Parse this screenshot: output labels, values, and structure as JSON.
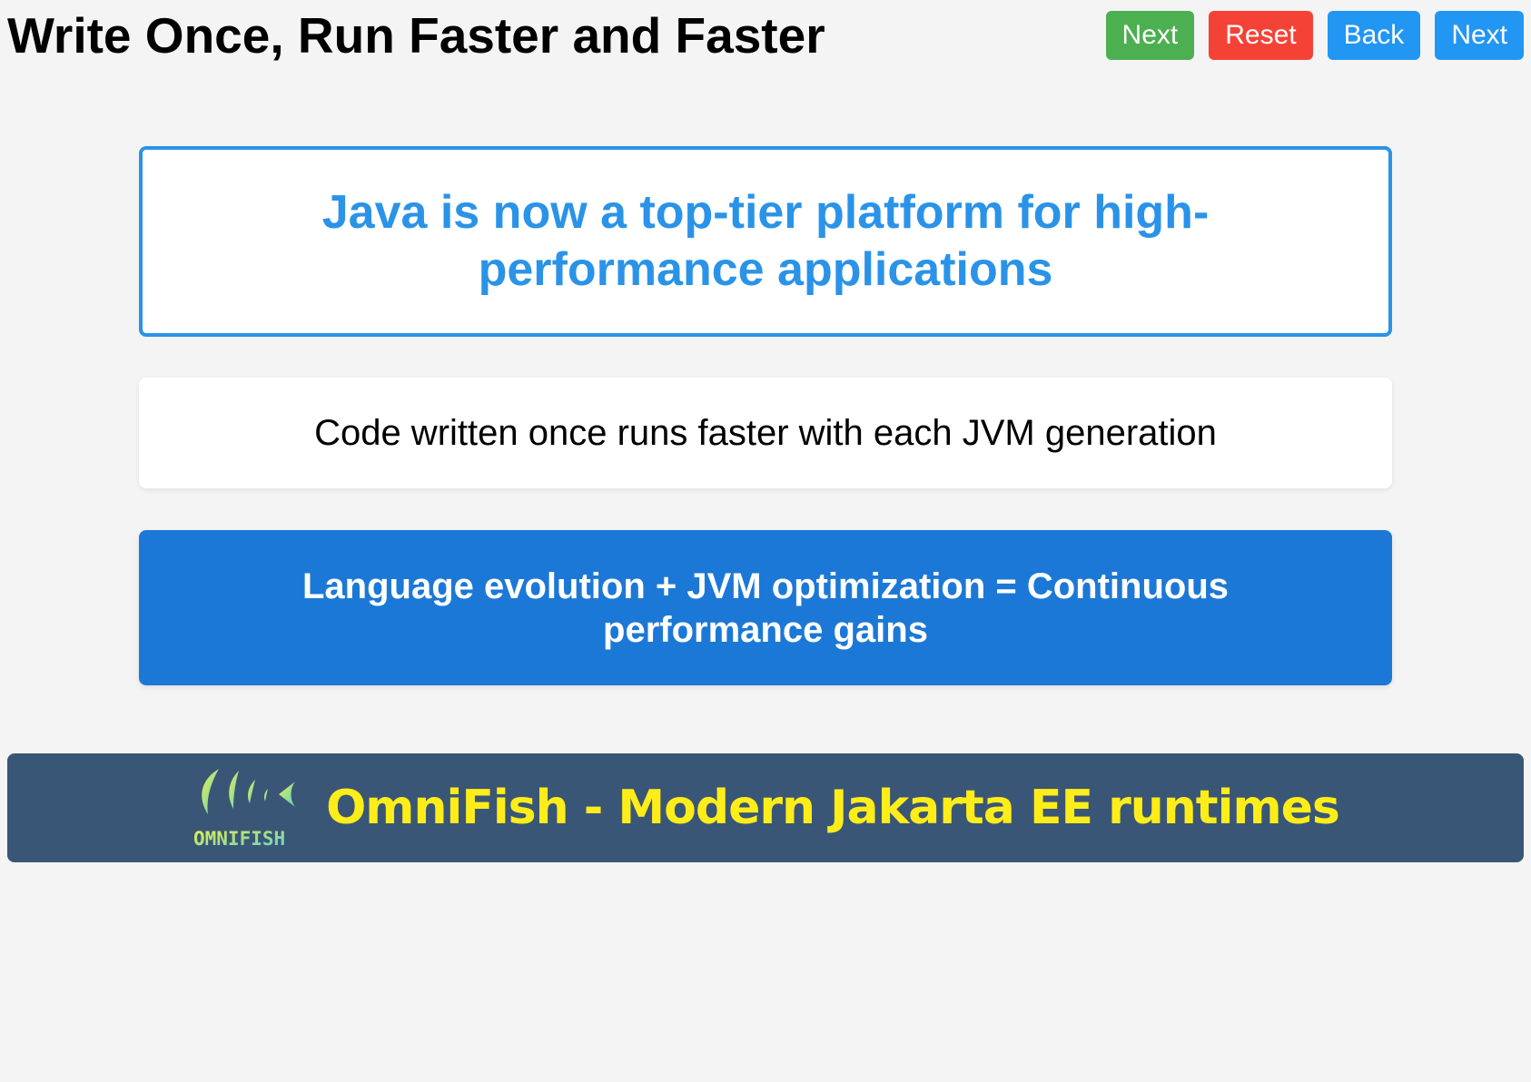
{
  "header": {
    "title": "Write Once, Run Faster and Faster",
    "buttons": {
      "next_primary": "Next",
      "reset": "Reset",
      "back": "Back",
      "next_secondary": "Next"
    }
  },
  "cards": {
    "highlight": "Java is now a top-tier platform for high-performance applications",
    "plain": "Code written once runs faster with each JVM generation",
    "solid": "Language evolution + JVM optimization = Continuous performance gains"
  },
  "footer": {
    "logo_text": "OMNIFISH",
    "tagline": "OmniFish - Modern Jakarta EE runtimes"
  },
  "colors": {
    "background": "#f4f4f4",
    "next_green": "#4caf50",
    "reset_red": "#f44336",
    "nav_blue": "#2196f3",
    "highlight_blue": "#2a93e8",
    "solid_card_blue": "#1c78d6",
    "footer_bg": "#3a5676",
    "footer_text": "#ffed1a"
  }
}
